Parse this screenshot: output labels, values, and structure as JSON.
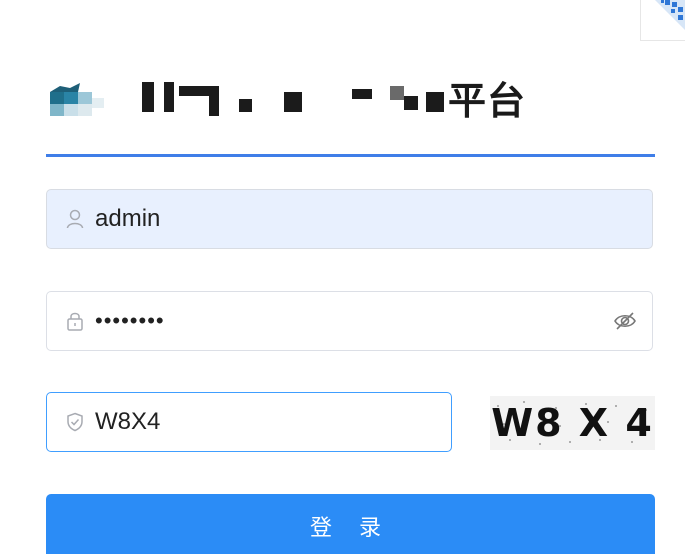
{
  "header": {
    "title_suffix": "平台"
  },
  "login": {
    "username_value": "admin",
    "password_value": "••••••••",
    "captcha_value": "W8X4",
    "captcha_image_text": "W8 X 4",
    "login_label": "登 录"
  },
  "colors": {
    "accent": "#3f7ee8",
    "button": "#2b8cf6",
    "focus_border": "#409eff",
    "autofill_bg": "#e8f0fe"
  }
}
